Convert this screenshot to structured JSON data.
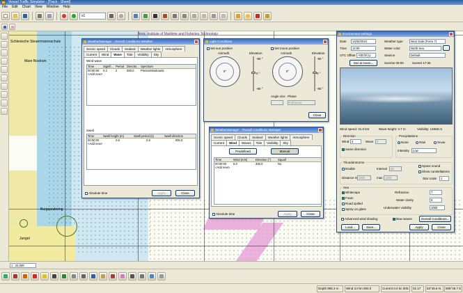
{
  "app": {
    "title": "Vessel Traffic Simulator - [Track - Sheet]"
  },
  "menu": [
    "File",
    "Edit",
    "Chart",
    "View",
    "Window",
    "Help"
  ],
  "toolbar": {
    "zoom_combo": "x1",
    "scale_value": "1 : 24,000"
  },
  "chart": {
    "header": "Area: Institute of Maritime and Fisheries Technology",
    "labels": [
      "Schlesische Steuermannsschule",
      "Mare Nostrum",
      "Burgsandering",
      "Jungel"
    ]
  },
  "weather_manager": {
    "title": "WeatherManager - Overall Conditions Weather",
    "tabs_row1": [
      "Scenic speed",
      "Clouds",
      "Seabed",
      "Weather lights",
      "Atmosphere"
    ],
    "tabs_row2": [
      "Current",
      "Wind",
      "Wave",
      "Tide",
      "Visibility",
      "Sky"
    ],
    "active_tab": "Wave",
    "wind_wave": {
      "label": "Wind wave",
      "columns": [
        "Time",
        "Signifi...",
        "Period",
        "Directio...",
        "Spectrum"
      ],
      "rows": [
        [
          "00:00:00",
          "0.3",
          "2",
          "000.0",
          "PiersonMoskowitz"
        ]
      ],
      "add_row": "<Add new>"
    },
    "swell": {
      "label": "Swell",
      "columns": [
        "Time",
        "Swell height (m)",
        "Swell period (s)",
        "Swell direction"
      ],
      "rows": [
        [
          "00:00:00",
          "0.6",
          "0.6",
          "000.0"
        ]
      ],
      "add_row": "<Add new>"
    },
    "absolute_time": "Absolute time",
    "apply": "Apply",
    "close": "Close"
  },
  "light_conditions": {
    "title": "Light Conditions",
    "set_sun": "Set sun position",
    "set_moon": "Set moon position",
    "azimuth": "Azimuth",
    "elevation": "Elevation",
    "sun_azimuth": "0°",
    "moon_azimuth": "0°",
    "angle_size": "Angle size",
    "phase": "Phase",
    "phase_value": "Full moon",
    "close": "Close",
    "scale_marks": [
      "-90 °",
      "0 °",
      "-90 °"
    ]
  },
  "weather_manager2": {
    "title": "WeatherManager - Overall Conditions Manager",
    "tabs_row1": [
      "Scenic speed",
      "Clouds",
      "Seabed",
      "Weather lights",
      "Atmosphere"
    ],
    "tabs_row2": [
      "Current",
      "Wind",
      "Waves",
      "Tide",
      "Visibility",
      "Sky"
    ],
    "active_tab": "Wind",
    "mode_predefined": "Predefined",
    "mode_manual": "Manual",
    "columns": [
      "Time",
      "Wind (m/s)",
      "Direction (°)",
      "Squall"
    ],
    "rows": [
      [
        "00:00:00",
        "5.0",
        "300.0",
        "No"
      ]
    ],
    "add_row": "<Add new>",
    "absolute_time": "Absolute time",
    "apply": "Apply",
    "close": "Close"
  },
  "env_settings": {
    "title": "Environment settings",
    "date_label": "Date",
    "date_value": "14/04/2010",
    "time_label": "Time",
    "time_value": "12:00",
    "utc_label": "UTC Offset",
    "utc_value": "+00:00 (U",
    "sun_moon": "Sun & moon...",
    "weather_type_label": "Weather type",
    "weather_type_value": "Near Gale (Force 7)",
    "water_color_label": "Water color",
    "water_color_value": "North Sea",
    "season_label": "Season",
    "season_value": "Default",
    "sunrise": "Sunrise  06:00",
    "sunset": "Sunset  17:36",
    "wind_speed": "Wind speed: 31.0 knt",
    "wave_height": "Wave height: 4.7 m",
    "visibility": "Visibility: 14668 m",
    "direction_group": "Direction",
    "wind_label": "Wind",
    "wind_value": "3",
    "wave_label": "Wave",
    "wave_value": "0",
    "same_direction": "Same direction",
    "precip_group": "Precipitations",
    "precip_none": "None",
    "precip_rain": "Rain",
    "precip_snow": "Snow",
    "intensity_label": "Intensity",
    "intensity_value": "Low",
    "thunder_group": "Thunderstorms",
    "enable": "Enable",
    "interval_label": "Interval",
    "interval_value": "30",
    "distance_min_label": "Distance min",
    "distance_min_value": "1000",
    "max_label": "max",
    "max_value": "1200",
    "space_sound": "Space sound",
    "show_constellations": "Show constellations",
    "star_scale_label": "Star scale",
    "star_scale_value": "1",
    "sea_group": "Sea",
    "whitecaps": "Whitecaps",
    "foam": "Foam",
    "road_spilled": "Road spilled",
    "spray_on_glass": "Spray on glass",
    "refraction_label": "Refraction",
    "refraction_value": "7",
    "water_clarity_label": "Water clarity",
    "water_clarity_value": "9",
    "underwater_vis_label": "Underwater visibility",
    "underwater_vis_value": "1000",
    "advanced_shading": "Advanced wind shading",
    "bow_waves": "Bow waves",
    "overall_conditions": "Overall Conditions...",
    "load": "Load...",
    "save": "Save...",
    "apply": "Apply",
    "close": "Close"
  },
  "status": {
    "depth": "Depth 995.3 m",
    "wind": "Wind 3.0 kn 000.0",
    "current": "Current 0.0 kn 000.0",
    "time": "01:17",
    "lat": "53°45.6 N",
    "lon": "009°48.7 E"
  }
}
